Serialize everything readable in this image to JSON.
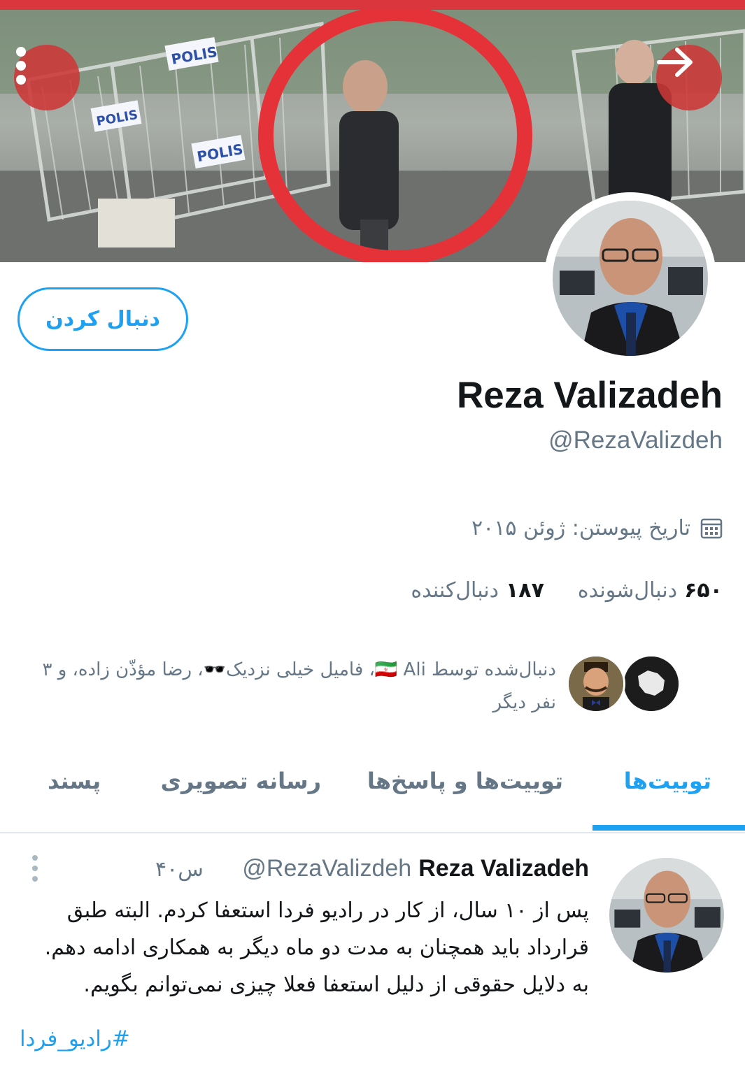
{
  "colors": {
    "accent": "#1da1f2",
    "top_bar": "#d9363e",
    "muted": "#657786",
    "text": "#14171a"
  },
  "banner": {
    "police_signs": [
      "POLIS",
      "POLIS",
      "POLIS"
    ]
  },
  "header_icons": {
    "more": "more-vertical-icon",
    "next": "arrow-right-icon"
  },
  "profile": {
    "name": "Reza Valizadeh",
    "handle": "@RezaValizdeh",
    "joined": "تاریخ پیوستن: ژوئن ۲۰۱۵",
    "following_count": "۶۵۰",
    "following_label": "دنبال‌شونده",
    "followers_count": "۱۸۷",
    "followers_label": "دنبال‌کننده",
    "follow_button": "دنبال کردن",
    "followed_by_line1": "دنبال‌شده توسط 🇮🇷 Ali، فامیل خیلی نزدیک🕶️، رضا مؤذّن زاده، و ۳",
    "followed_by_line2": "نفر دیگر"
  },
  "tabs": [
    {
      "label": "توییت‌ها",
      "active": true
    },
    {
      "label": "توییت‌ها و پاسخ‌ها",
      "active": false
    },
    {
      "label": "رسانه تصویری",
      "active": false
    },
    {
      "label": "پسند",
      "active": false
    }
  ],
  "tweet": {
    "name": "Reza Valizadeh",
    "handle": "@RezaValizdeh",
    "time": "۴۰س",
    "text": "پس از ۱۰ سال، از کار در رادیو فردا استعفا کردم. البته طبق قرارداد باید همچنان به مدت دو ماه دیگر به همکاری ادامه دهم. به دلایل حقوقی از دلیل استعفا فعلا چیزی نمی‌توانم بگویم.",
    "hashtag": "#رادیو_فردا"
  }
}
